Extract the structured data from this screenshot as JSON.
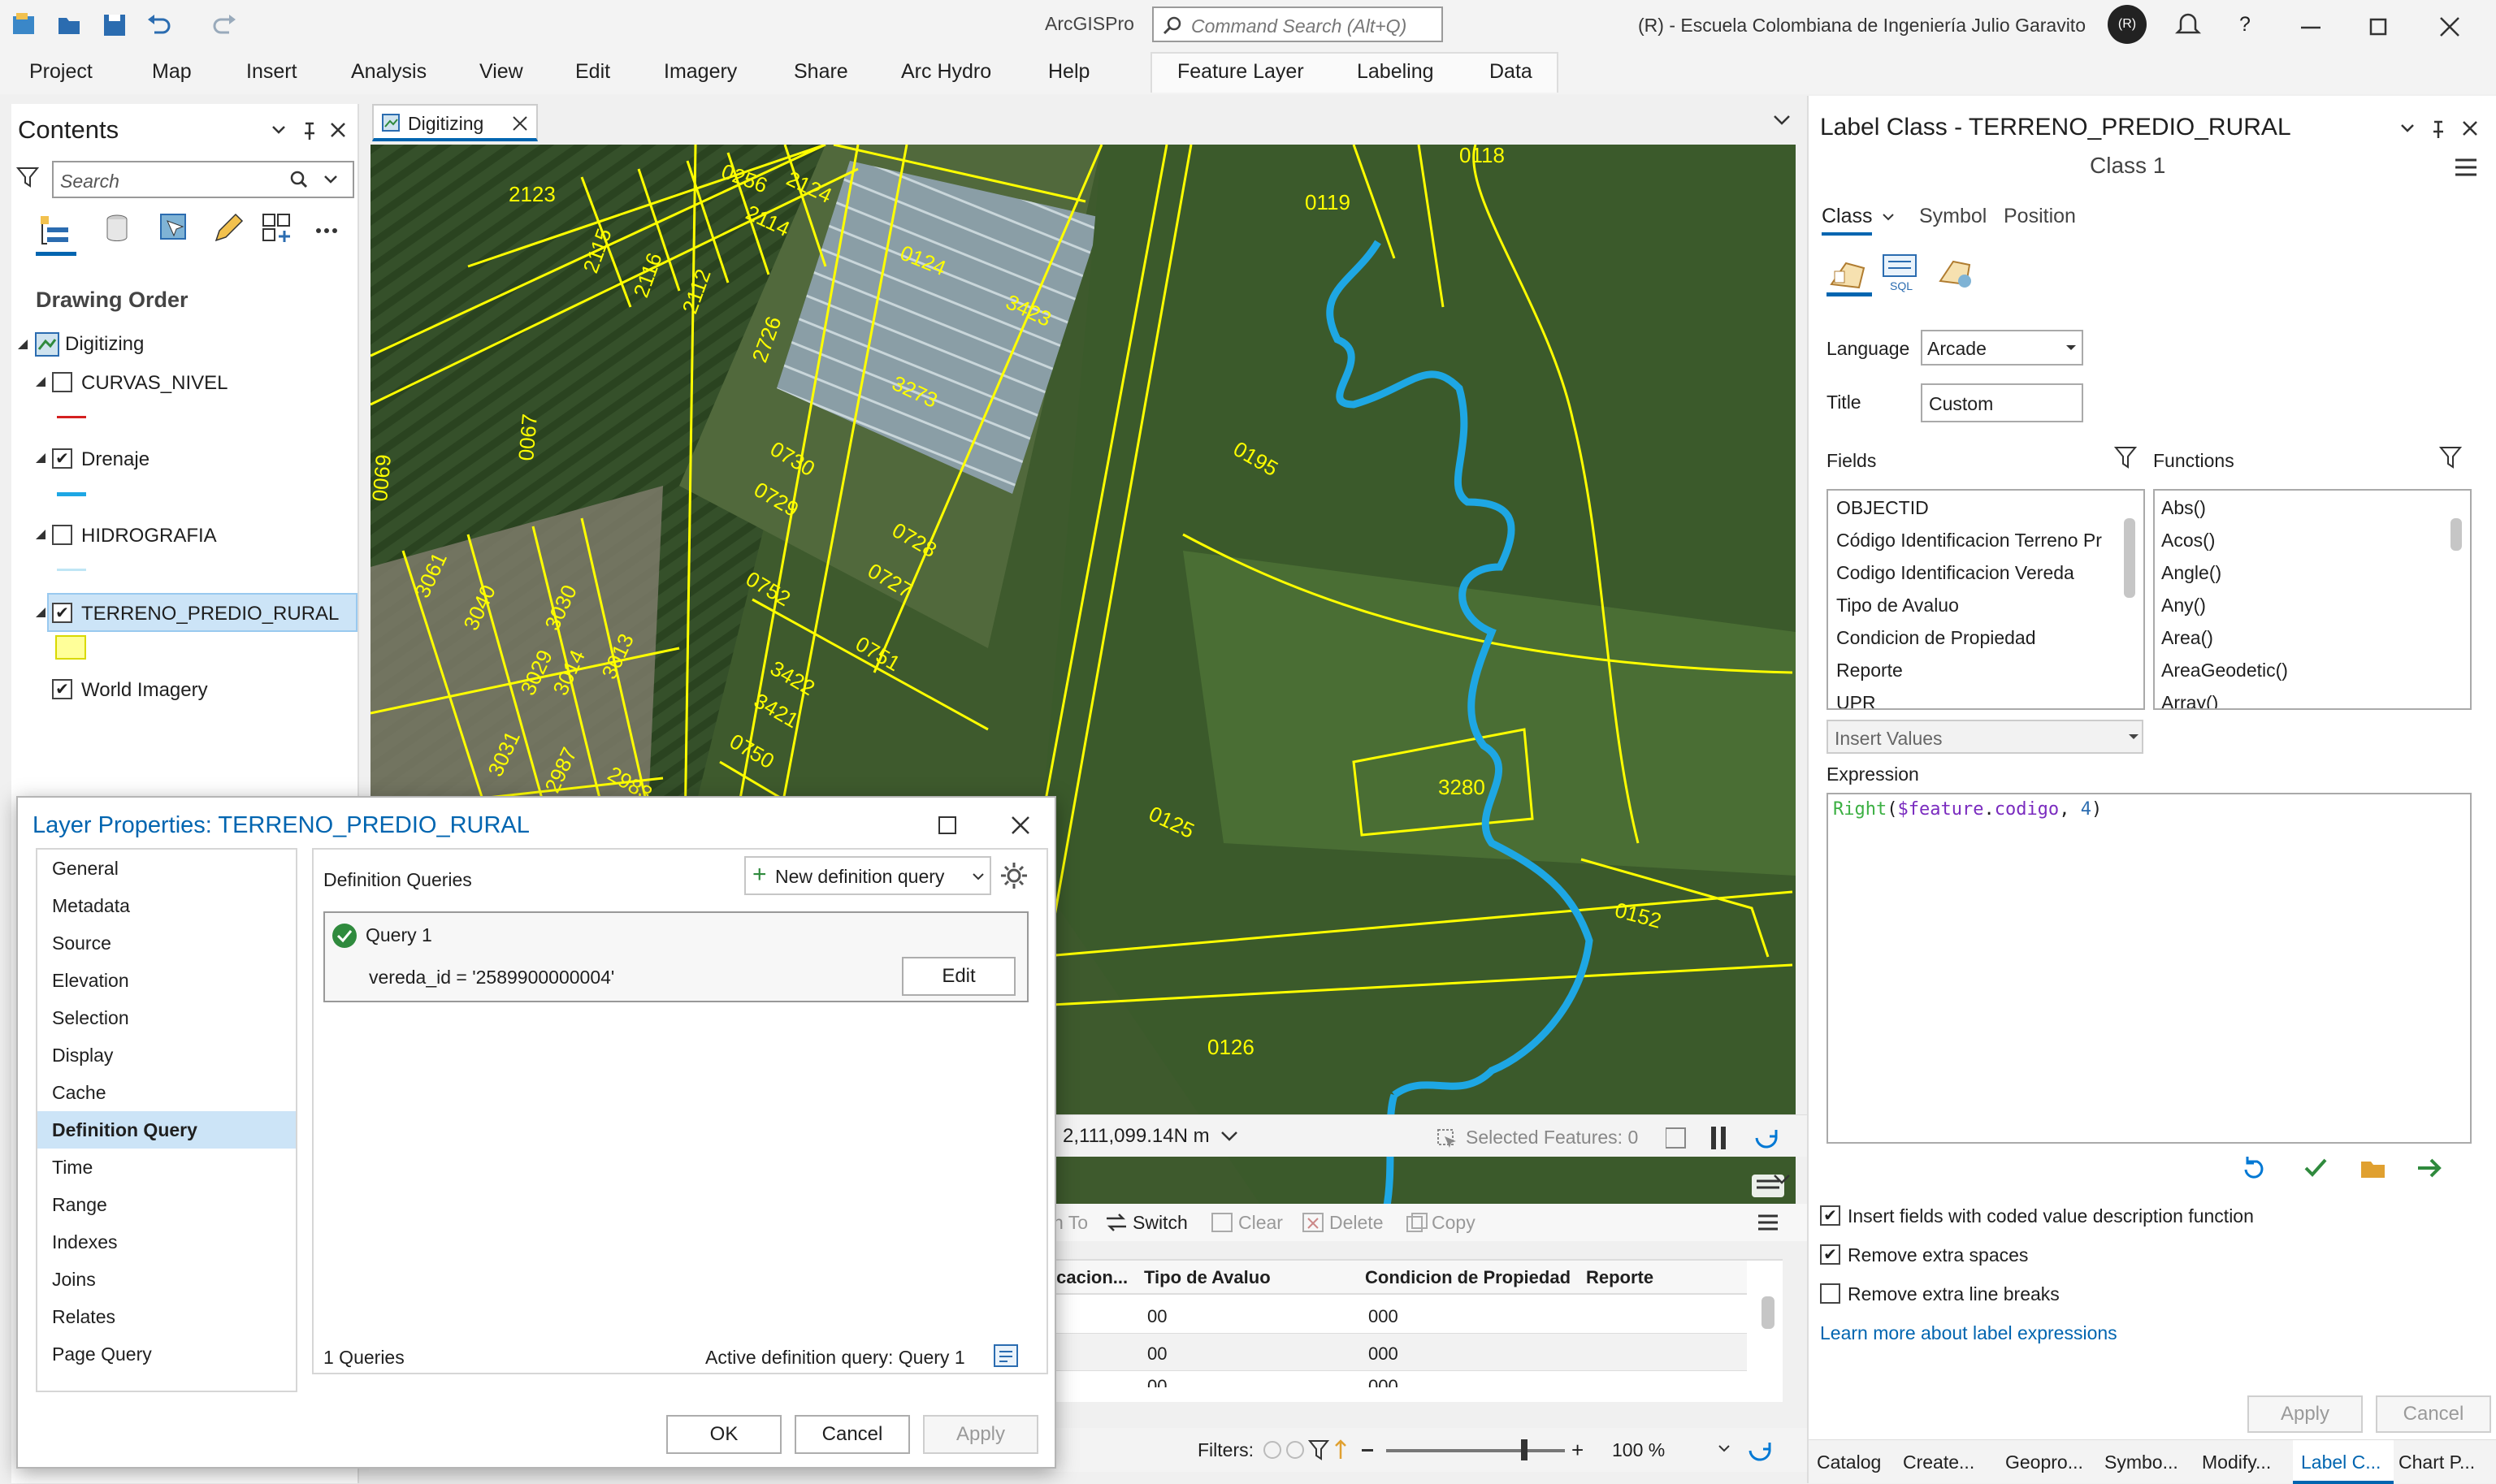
{
  "app": {
    "title": "ArcGISPro",
    "search_placeholder": "Command Search (Alt+Q)",
    "org": "(R) - Escuela Colombiana de Ingeniería Julio Garavito",
    "avatar_initials": "(R)",
    "help": "?"
  },
  "ribbon": {
    "tabs": [
      "Project",
      "Map",
      "Insert",
      "Analysis",
      "View",
      "Edit",
      "Imagery",
      "Share",
      "Arc Hydro",
      "Help"
    ],
    "context_tabs": [
      "Feature Layer",
      "Labeling",
      "Data"
    ]
  },
  "contents": {
    "title": "Contents",
    "search_placeholder": "Search",
    "drawing_order": "Drawing Order",
    "map": "Digitizing",
    "layers": [
      {
        "name": "CURVAS_NIVEL",
        "checked": false,
        "swatch": "#d42020"
      },
      {
        "name": "Drenaje",
        "checked": true,
        "swatch": "#1ea7e4"
      },
      {
        "name": "HIDROGRAFIA",
        "checked": false,
        "swatch": "#bfe6f5"
      },
      {
        "name": "TERRENO_PREDIO_RURAL",
        "checked": true,
        "swatch": "#ffff99"
      },
      {
        "name": "World Imagery",
        "checked": true
      }
    ]
  },
  "map_view": {
    "tab": "Digitizing",
    "coords": "2,111,099.14N m",
    "selected": "Selected Features: 0",
    "labels": [
      "0256",
      "2124",
      "2123",
      "2115",
      "2114",
      "2116",
      "2112",
      "2726",
      "0124",
      "3423",
      "3273",
      "0067",
      "0730",
      "0729",
      "0728",
      "0727",
      "0752",
      "0751",
      "3422",
      "3421",
      "0750",
      "2983",
      "2906",
      "3040",
      "3030",
      "3029",
      "3014",
      "3013",
      "0118",
      "0119",
      "0195",
      "3280",
      "0125",
      "0152",
      "0126",
      "0069",
      "3061",
      "3031",
      "2987"
    ]
  },
  "table": {
    "toolbar": [
      "Switch",
      "Clear",
      "Delete",
      "Copy"
    ],
    "partial_toolbar": "n To",
    "columns": [
      "icacion...",
      "Tipo de Avaluo",
      "Condicion de Propiedad",
      "Reporte"
    ],
    "rows": [
      [
        "",
        "00",
        "000",
        ""
      ],
      [
        "",
        "00",
        "000",
        ""
      ],
      [
        "",
        "00",
        "000",
        ""
      ]
    ],
    "filters": "Filters:",
    "zoom": "100 %"
  },
  "dialog": {
    "title": "Layer Properties: TERRENO_PREDIO_RURAL",
    "nav": [
      "General",
      "Metadata",
      "Source",
      "Elevation",
      "Selection",
      "Display",
      "Cache",
      "Definition Query",
      "Time",
      "Range",
      "Indexes",
      "Joins",
      "Relates",
      "Page Query"
    ],
    "selected_nav": "Definition Query",
    "section": "Definition Queries",
    "new_query": "New definition query",
    "query_name": "Query 1",
    "query_expr": "vereda_id = '2589900000004'",
    "edit": "Edit",
    "count": "1 Queries",
    "active": "Active definition query: Query 1",
    "ok": "OK",
    "cancel": "Cancel",
    "apply": "Apply"
  },
  "label_panel": {
    "title": "Label Class - TERRENO_PREDIO_RURAL",
    "class_name": "Class 1",
    "tabs": [
      "Class",
      "Symbol",
      "Position"
    ],
    "sql_label": "SQL",
    "language_label": "Language",
    "language": "Arcade",
    "title_label": "Title",
    "title_value": "Custom",
    "fields_label": "Fields",
    "functions_label": "Functions",
    "fields": [
      "OBJECTID",
      "Código Identificacion Terreno Pr",
      "Codigo Identificacion Vereda",
      "Tipo de Avaluo",
      "Condicion de Propiedad",
      "Reporte",
      "UPR"
    ],
    "functions": [
      "Abs()",
      "Acos()",
      "Angle()",
      "Any()",
      "Area()",
      "AreaGeodetic()",
      "Array()"
    ],
    "insert_values": "Insert Values",
    "expression_label": "Expression",
    "expr_fn": "Right",
    "expr_var": "$feature",
    "expr_prop": "codigo",
    "expr_num": "4",
    "checks": [
      {
        "label": "Insert fields with coded value description function",
        "checked": true
      },
      {
        "label": "Remove extra spaces",
        "checked": true
      },
      {
        "label": "Remove extra line breaks",
        "checked": false
      }
    ],
    "learn_more": "Learn more about label expressions",
    "apply": "Apply",
    "cancel": "Cancel"
  },
  "bottom_tabs": [
    "Catalog",
    "Create...",
    "Geopro...",
    "Symbo...",
    "Modify...",
    "Label C...",
    "Chart P..."
  ],
  "colors": {
    "accent": "#0065b0",
    "selected": "#cce4f7",
    "parcel": "#ffff00",
    "river": "#1ea7e4"
  }
}
